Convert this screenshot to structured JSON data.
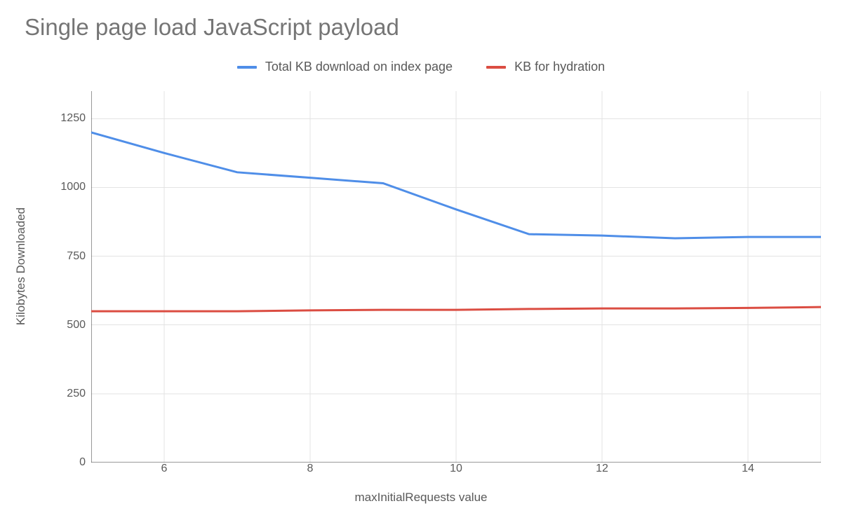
{
  "chart_data": {
    "type": "line",
    "title": "Single page load JavaScript payload",
    "xlabel": "maxInitialRequests value",
    "ylabel": "Kilobytes Downloaded",
    "x": [
      5,
      6,
      7,
      8,
      9,
      10,
      11,
      12,
      13,
      14,
      15
    ],
    "series": [
      {
        "name": "Total KB download on index page",
        "color": "#4f8ee8",
        "values": [
          1200,
          1125,
          1055,
          1035,
          1015,
          920,
          830,
          825,
          815,
          820,
          820
        ]
      },
      {
        "name": "KB for hydration",
        "color": "#db4d42",
        "values": [
          550,
          550,
          550,
          553,
          555,
          555,
          558,
          560,
          560,
          562,
          565
        ]
      }
    ],
    "xlim": [
      5,
      15
    ],
    "ylim": [
      0,
      1350
    ],
    "y_ticks": [
      0,
      250,
      500,
      750,
      1000,
      1250
    ],
    "x_ticks": [
      6,
      8,
      10,
      12,
      14
    ]
  }
}
